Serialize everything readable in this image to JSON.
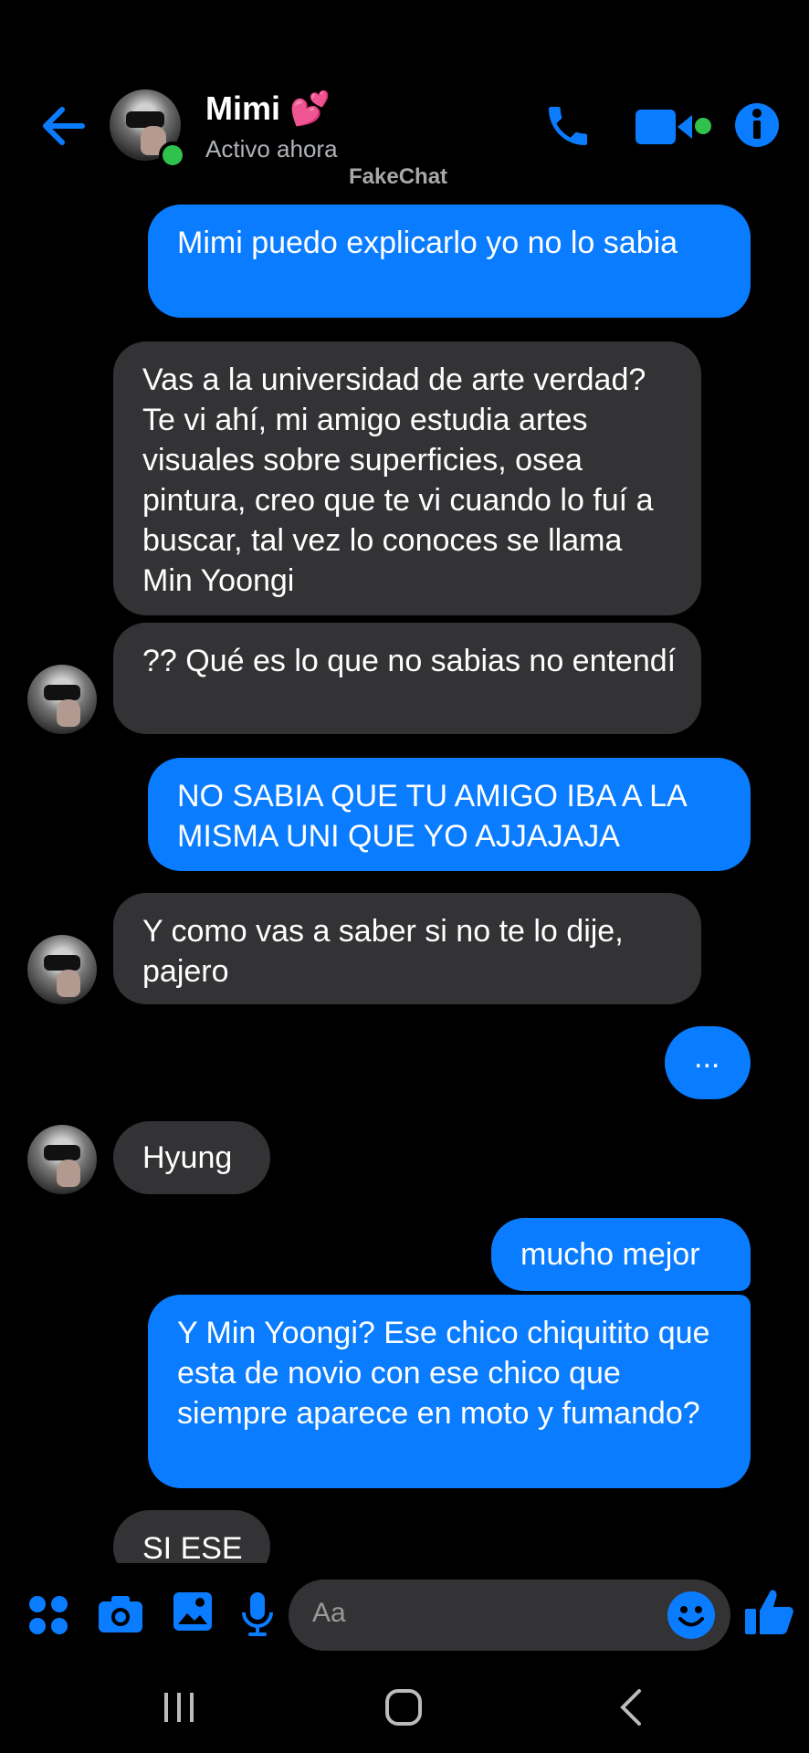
{
  "header": {
    "contact_name": "Mimi",
    "name_emoji": "💕",
    "status": "Activo ahora",
    "watermark": "FakeChat",
    "icons": [
      "back-arrow-icon",
      "phone-icon",
      "video-camera-icon",
      "info-icon"
    ]
  },
  "messages": [
    {
      "from": "me",
      "text": "Mimi puedo explicarlo yo no lo sabia"
    },
    {
      "from": "them",
      "text": "Vas a la universidad de arte verdad? Te vi ahí, mi amigo estudia artes visuales sobre superficies, osea pintura, creo que te vi cuando lo fuí a buscar, tal vez lo conoces se llama Min Yoongi"
    },
    {
      "from": "them",
      "text": "?? Qué es lo que no sabias no entendí"
    },
    {
      "from": "me",
      "text": "NO SABIA QUE TU AMIGO IBA A LA MISMA UNI QUE YO AJJAJAJA"
    },
    {
      "from": "them",
      "text": "Y como vas a saber si no te lo dije, pajero"
    },
    {
      "from": "me",
      "text": "..."
    },
    {
      "from": "them",
      "text": "Hyung"
    },
    {
      "from": "me",
      "text": "mucho mejor"
    },
    {
      "from": "me",
      "text": "Y Min Yoongi? Ese chico chiquitito que esta de novio con ese chico que siempre aparece en moto y fumando?"
    },
    {
      "from": "them",
      "text": "SI ESE"
    }
  ],
  "composer": {
    "placeholder": "Aa",
    "icons": [
      "apps-icon",
      "camera-icon",
      "gallery-icon",
      "microphone-icon",
      "emoji-icon",
      "like-icon"
    ]
  },
  "colors": {
    "accent": "#0a7cff",
    "outgoing_bubble": "#0a7cff",
    "incoming_bubble": "#333335",
    "background": "#000000",
    "online_dot": "#31c24d"
  }
}
